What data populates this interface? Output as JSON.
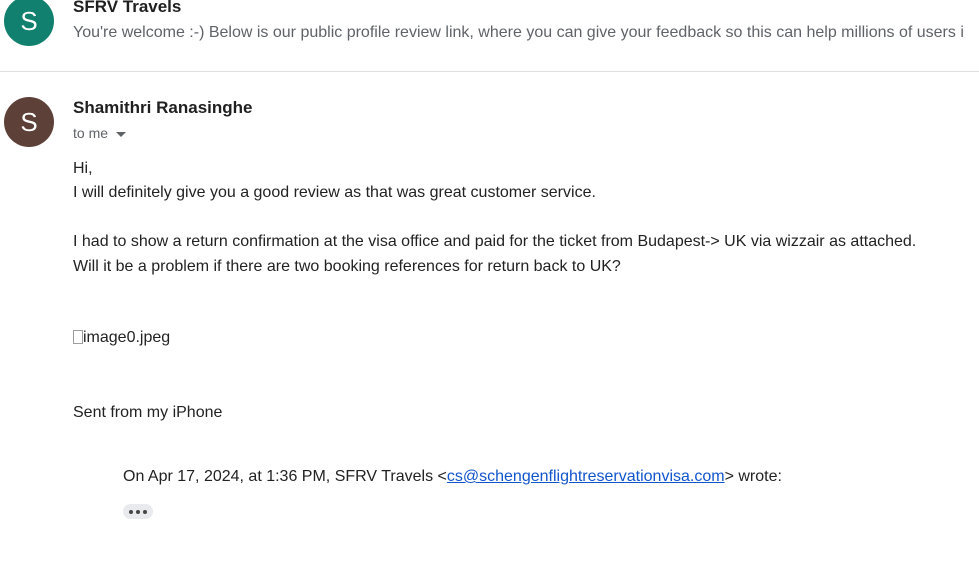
{
  "collapsed_message": {
    "avatar_letter": "S",
    "sender": "SFRV Travels",
    "snippet": "You're welcome :-) Below is our public profile review link, where you can give your feedback so this can help millions of users i"
  },
  "message": {
    "avatar_letter": "S",
    "sender": "Shamithri Ranasinghe",
    "recipient": "to me",
    "body_lines": [
      "Hi,",
      "I will definitely give you a good review as that was great customer service.",
      "I had to show a return confirmation at the visa office and paid for the ticket from Budapest-> UK via wizzair as attached.",
      "Will it be a problem if there are two booking references for return back to UK?"
    ],
    "attachment_alt": "image0.jpeg",
    "signature": "Sent from my iPhone",
    "quote": {
      "prefix": "On Apr 17, 2024, at 1:36 PM, SFRV Travels <",
      "email": "cs@schengenflightreservationvisa.com",
      "suffix": "> wrote:"
    }
  },
  "colors": {
    "avatar_sfrv": "#12806e",
    "avatar_shamithri": "#5d4037",
    "link": "#1155cc",
    "muted_text": "#5f6368"
  },
  "icons": [
    "caret-down-icon",
    "broken-image-icon",
    "more-dots-icon"
  ]
}
